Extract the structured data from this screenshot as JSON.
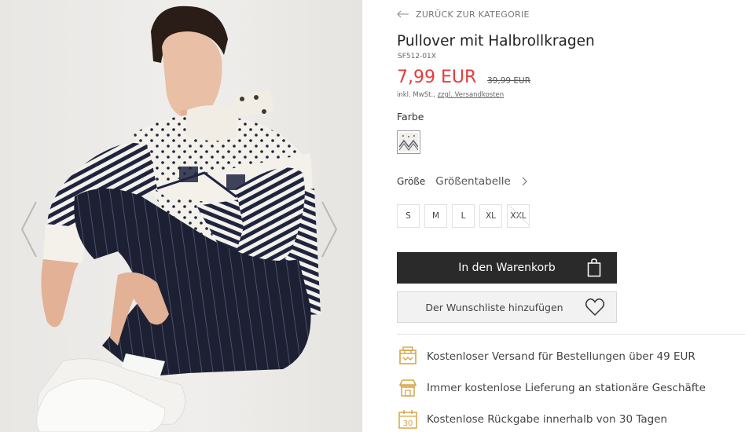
{
  "navigation": {
    "back_label": "ZURÜCK ZUR KATEGORIE"
  },
  "product": {
    "title": "Pullover mit Halbrollkragen",
    "sku": "SF512-01X",
    "price": "7,99 EUR",
    "old_price": "39,99 EUR",
    "tax_note": "inkl. MwSt.,",
    "shipping_link": "zzgl. Versandkosten"
  },
  "color": {
    "label": "Farbe"
  },
  "size": {
    "label": "Größe",
    "chart_label": "Größentabelle",
    "options": [
      {
        "label": "S",
        "available": true
      },
      {
        "label": "M",
        "available": true
      },
      {
        "label": "L",
        "available": true
      },
      {
        "label": "XL",
        "available": true
      },
      {
        "label": "XXL",
        "available": false
      }
    ]
  },
  "actions": {
    "cart_label": "In den Warenkorb",
    "wishlist_label": "Der Wunschliste hinzufügen"
  },
  "benefits": [
    {
      "icon": "package-icon",
      "text": "Kostenloser Versand für Bestellungen über 49 EUR"
    },
    {
      "icon": "store-icon",
      "text": "Immer kostenlose Lieferung an stationäre Geschäfte"
    },
    {
      "icon": "calendar-30-icon",
      "text": "Kostenlose Rückgabe innerhalb von 30 Tagen"
    }
  ],
  "calendar_number": "30",
  "colors": {
    "sale_price": "#e43b3b",
    "cart_button": "#2a2a2a",
    "benefit_icon": "#d6a64a"
  }
}
